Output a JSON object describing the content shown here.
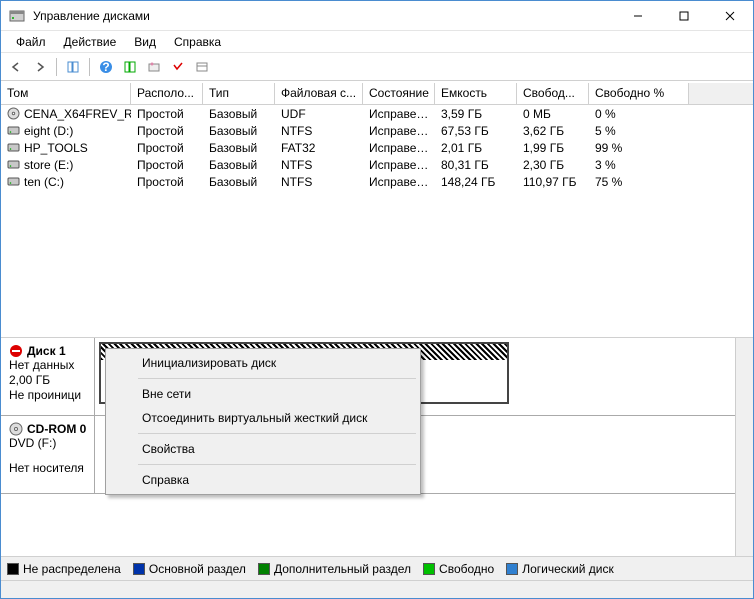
{
  "window": {
    "title": "Управление дисками",
    "controls": {
      "min": "–",
      "max": "☐",
      "close": "✕"
    }
  },
  "menu": {
    "file": "Файл",
    "action": "Действие",
    "view": "Вид",
    "help": "Справка"
  },
  "columns": {
    "volume": "Том",
    "layout": "Располо...",
    "type": "Тип",
    "fs": "Файловая с...",
    "status": "Состояние",
    "capacity": "Емкость",
    "free": "Свобод...",
    "freep": "Свободно %"
  },
  "volumes": [
    {
      "icon": "cd",
      "name": "CENA_X64FREV_R...",
      "layout": "Простой",
      "type": "Базовый",
      "fs": "UDF",
      "status": "Исправен...",
      "capacity": "3,59 ГБ",
      "free": "0 МБ",
      "freep": "0 %"
    },
    {
      "icon": "hd",
      "name": "eight (D:)",
      "layout": "Простой",
      "type": "Базовый",
      "fs": "NTFS",
      "status": "Исправен...",
      "capacity": "67,53 ГБ",
      "free": "3,62 ГБ",
      "freep": "5 %"
    },
    {
      "icon": "hd",
      "name": "HP_TOOLS",
      "layout": "Простой",
      "type": "Базовый",
      "fs": "FAT32",
      "status": "Исправен...",
      "capacity": "2,01 ГБ",
      "free": "1,99 ГБ",
      "freep": "99 %"
    },
    {
      "icon": "hd",
      "name": "store (E:)",
      "layout": "Простой",
      "type": "Базовый",
      "fs": "NTFS",
      "status": "Исправен...",
      "capacity": "80,31 ГБ",
      "free": "2,30 ГБ",
      "freep": "3 %"
    },
    {
      "icon": "hd",
      "name": "ten (C:)",
      "layout": "Простой",
      "type": "Базовый",
      "fs": "NTFS",
      "status": "Исправен...",
      "capacity": "148,24 ГБ",
      "free": "110,97 ГБ",
      "freep": "75 %"
    }
  ],
  "disk1": {
    "title": "Диск 1",
    "line1": "Нет данных",
    "line2": "2,00 ГБ",
    "line3": "Не проиници"
  },
  "cdrom": {
    "title": "CD-ROM 0",
    "line1": "DVD (F:)",
    "line2": "Нет носителя"
  },
  "context_menu": {
    "initialize": "Инициализировать диск",
    "offline": "Вне сети",
    "detach_vhd": "Отсоединить виртуальный жесткий диск",
    "properties": "Свойства",
    "help": "Справка"
  },
  "legend": {
    "unallocated": "Не распределена",
    "primary": "Основной раздел",
    "extended": "Дополнительный раздел",
    "free": "Свободно",
    "logical": "Логический диск"
  },
  "colors": {
    "unallocated": "#000000",
    "primary": "#0033aa",
    "extended": "#008000",
    "free": "#00c000",
    "logical": "#3080d0"
  }
}
